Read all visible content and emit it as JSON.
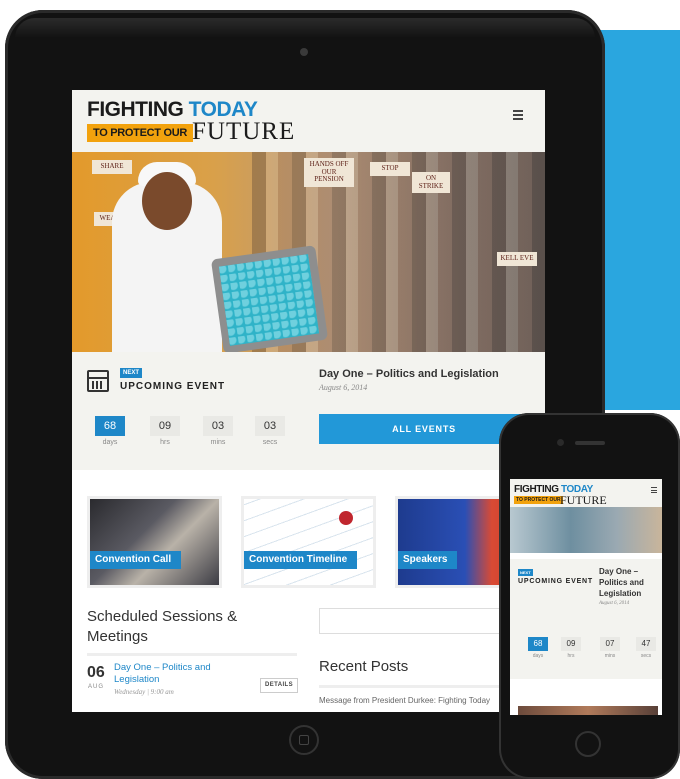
{
  "brand": {
    "line1_black": "FIGHTING",
    "line1_blue": "TODAY",
    "tagline": "TO PROTECT OUR",
    "future": "FUTURE"
  },
  "colors": {
    "accent": "#1e87c8",
    "tag": "#f2a20d",
    "panel": "#2aa6df"
  },
  "hero_signs": [
    "SHARE",
    "WEALTH",
    "HANDS OFF OUR PENSION",
    "STOP",
    "ON STRIKE",
    "KELL EVE"
  ],
  "event": {
    "badge": "NEXT",
    "heading": "UPCOMING EVENT",
    "title": "Day One – Politics and Legislation",
    "date": "August 6, 2014",
    "countdown": [
      {
        "value": "68",
        "label": "days"
      },
      {
        "value": "09",
        "label": "hrs"
      },
      {
        "value": "03",
        "label": "mins"
      },
      {
        "value": "03",
        "label": "secs"
      }
    ],
    "all_events_label": "ALL EVENTS"
  },
  "features": [
    {
      "label": "Convention Call"
    },
    {
      "label": "Convention Timeline"
    },
    {
      "label": "Speakers"
    }
  ],
  "sessions": {
    "heading": "Scheduled Sessions & Meetings",
    "items": [
      {
        "day": "06",
        "month": "AUG",
        "title": "Day One – Politics and Legislation",
        "time": "Wednesday | 9:00 am",
        "button": "DETAILS"
      }
    ]
  },
  "recent": {
    "heading": "Recent Posts",
    "items": [
      "Message from President Durkee: Fighting Today"
    ]
  },
  "phone": {
    "title": "Day One – Politics and Legislation",
    "date": "August 6, 2014",
    "heading": "UPCOMING EVENT",
    "badge": "NEXT",
    "countdown": [
      {
        "value": "68",
        "label": "days"
      },
      {
        "value": "09",
        "label": "hrs"
      },
      {
        "value": "07",
        "label": "mins"
      },
      {
        "value": "47",
        "label": "secs"
      }
    ]
  }
}
